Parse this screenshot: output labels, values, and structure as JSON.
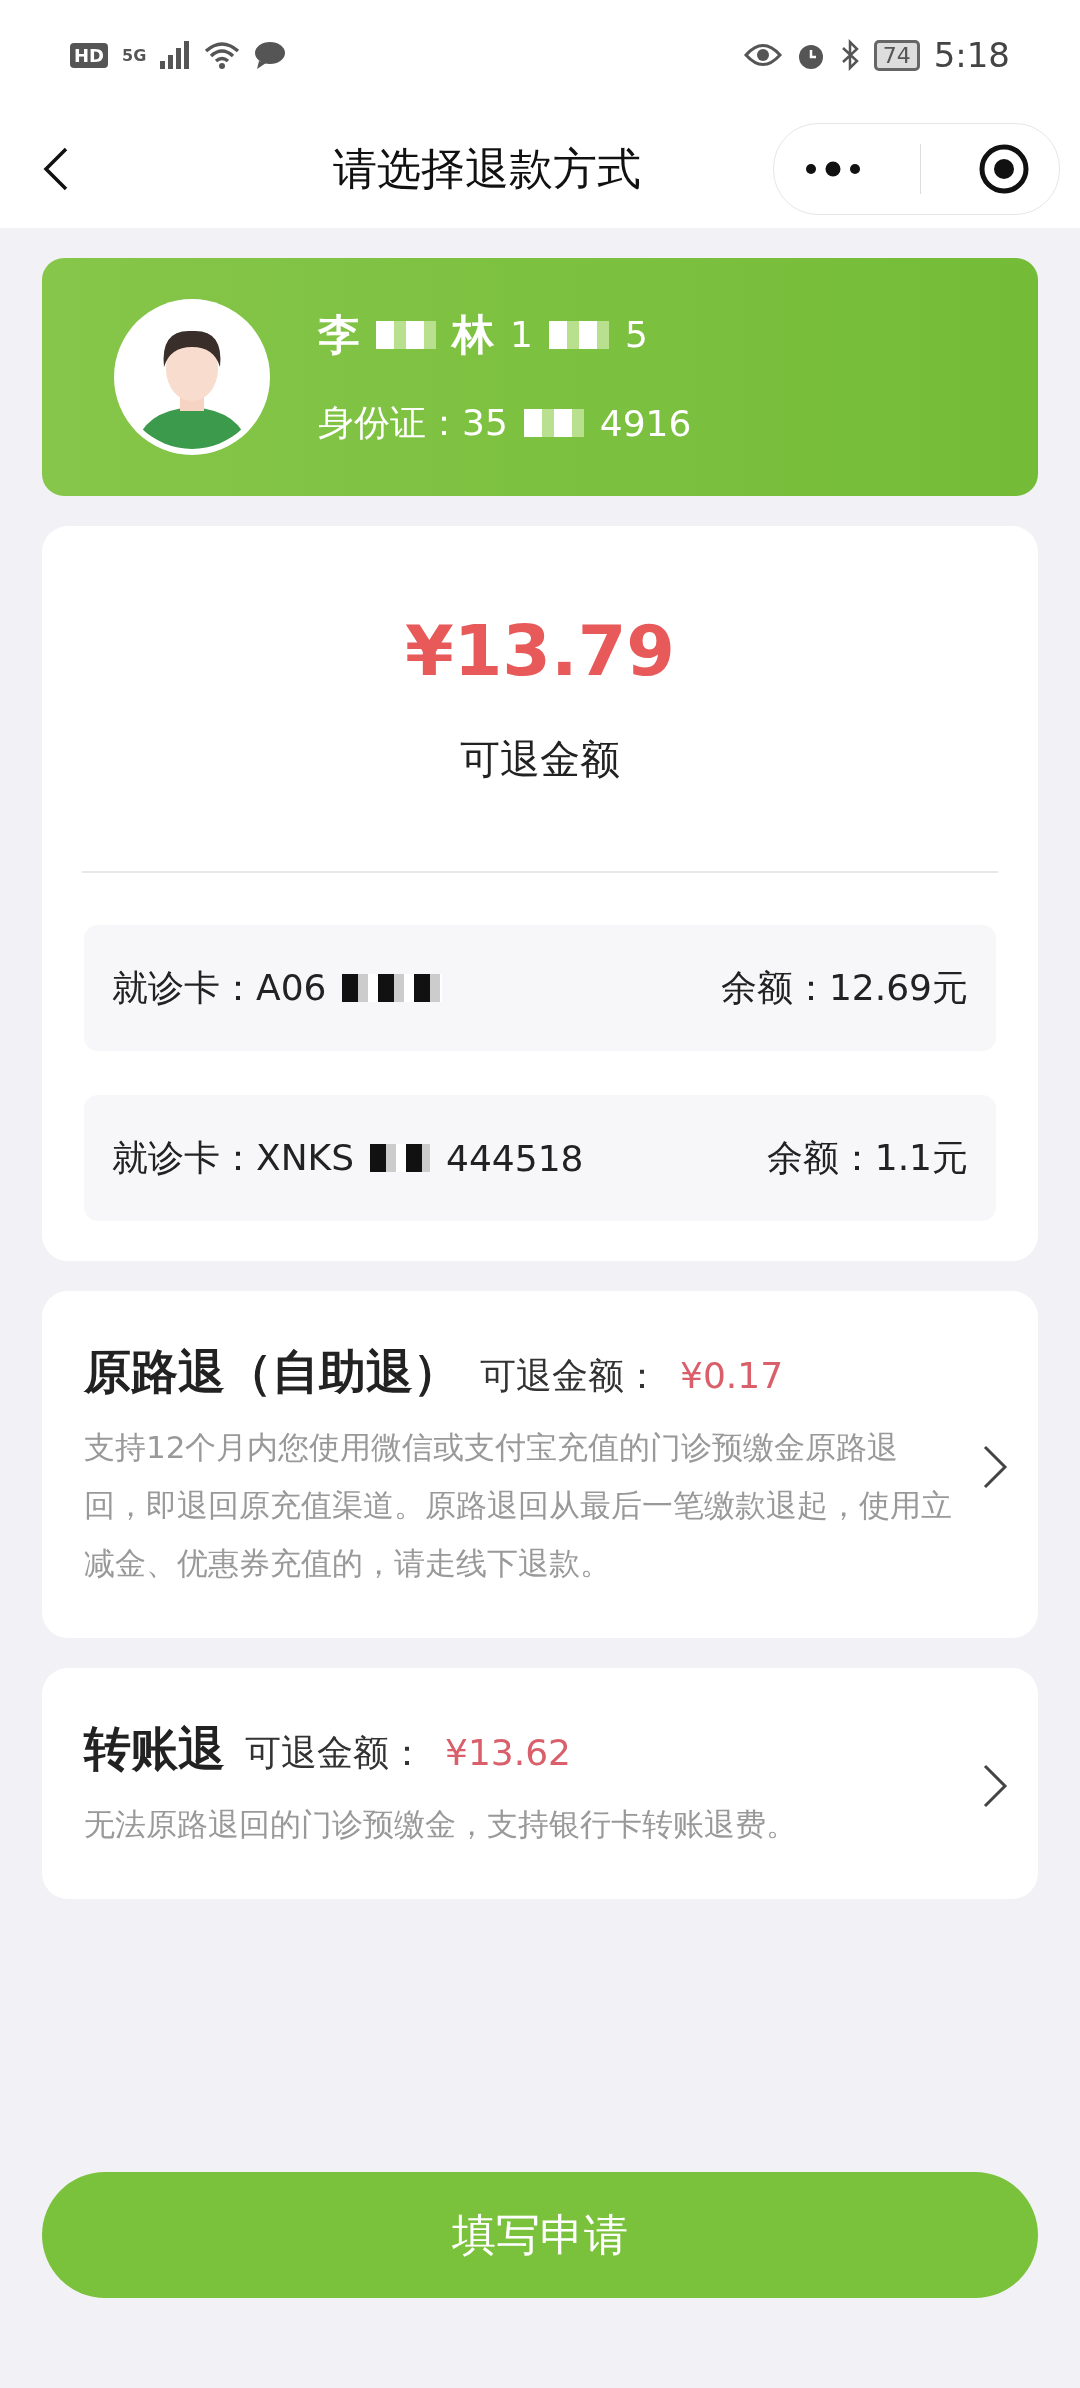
{
  "status_bar": {
    "hd": "HD",
    "time": "5:18",
    "battery": "74",
    "network": "5G"
  },
  "header": {
    "title": "请选择退款方式"
  },
  "patient": {
    "name_segments": [
      "李",
      "林"
    ],
    "phone_segments": [
      "1",
      "5"
    ],
    "id_segments": [
      "身份证：35",
      "4916"
    ]
  },
  "refund": {
    "amount": "¥13.79",
    "label": "可退金额"
  },
  "cards": [
    {
      "number_segments": [
        "就诊卡：A06"
      ],
      "balance": "余额：12.69元"
    },
    {
      "number_segments": [
        "就诊卡：XNKS",
        "444518"
      ],
      "balance": "余额：1.1元"
    }
  ],
  "options": [
    {
      "title": "原路退（自助退）",
      "amount_label": "可退金额：",
      "amount": "¥0.17",
      "description": "支持12个月内您使用微信或支付宝充值的门诊预缴金原路退回，即退回原充值渠道。原路退回从最后一笔缴款退起，使用立减金、优惠券充值的，请走线下退款。"
    },
    {
      "title": "转账退",
      "amount_label": "可退金额：",
      "amount": "¥13.62",
      "description": "无法原路退回的门诊预缴金，支持银行卡转账退费。"
    }
  ],
  "submit_button": "填写申请"
}
